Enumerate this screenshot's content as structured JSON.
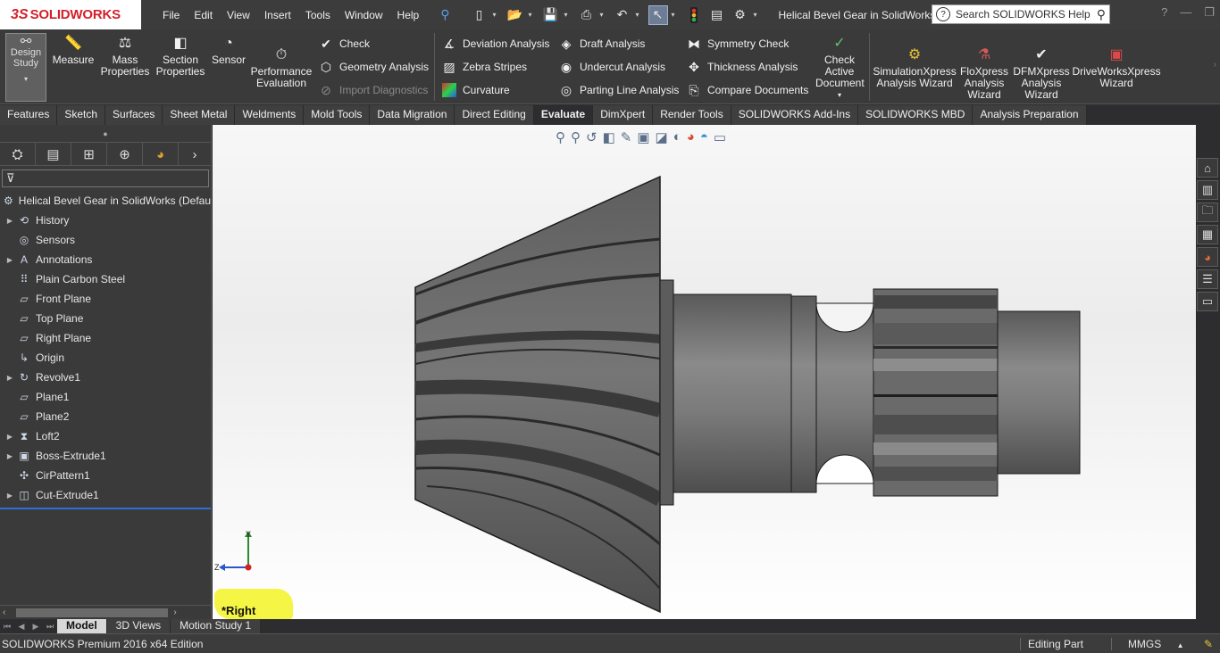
{
  "app": {
    "logo_text": "SOLIDWORKS",
    "document_title": "Helical Bevel Gear in SolidWorks",
    "search_placeholder": "Search SOLIDWORKS Help"
  },
  "menu": [
    "File",
    "Edit",
    "View",
    "Insert",
    "Tools",
    "Window",
    "Help"
  ],
  "command_manager": {
    "design_study": "Design Study",
    "large_buttons": [
      {
        "label": "Measure",
        "icon": "measure-icon"
      },
      {
        "label": "Mass Properties",
        "icon": "mass-properties-icon"
      },
      {
        "label": "Section Properties",
        "icon": "section-properties-icon"
      },
      {
        "label": "Sensor",
        "icon": "sensor-icon"
      },
      {
        "label": "Performance Evaluation",
        "icon": "performance-evaluation-icon"
      }
    ],
    "small_buttons": {
      "check": "Check",
      "geometry_analysis": "Geometry Analysis",
      "import_diagnostics": "Import Diagnostics",
      "deviation_analysis": "Deviation Analysis",
      "zebra_stripes": "Zebra Stripes",
      "curvature": "Curvature",
      "draft_analysis": "Draft Analysis",
      "undercut_analysis": "Undercut Analysis",
      "parting_line_analysis": "Parting Line Analysis",
      "symmetry_check": "Symmetry Check",
      "thickness_analysis": "Thickness Analysis",
      "compare_documents": "Compare Documents"
    },
    "check_active_document": "Check Active Document",
    "wizards": [
      "SimulationXpress Analysis Wizard",
      "FloXpress Analysis Wizard",
      "DFMXpress Analysis Wizard",
      "DriveWorksXpress Wizard"
    ]
  },
  "tabs": [
    "Features",
    "Sketch",
    "Surfaces",
    "Sheet Metal",
    "Weldments",
    "Mold Tools",
    "Data Migration",
    "Direct Editing",
    "Evaluate",
    "DimXpert",
    "Render Tools",
    "SOLIDWORKS Add-Ins",
    "SOLIDWORKS MBD",
    "Analysis Preparation"
  ],
  "active_tab": "Evaluate",
  "feature_tree": {
    "root": "Helical Bevel Gear in SolidWorks  (Defau",
    "items": [
      {
        "label": "History",
        "icon": "history-icon",
        "expandable": true
      },
      {
        "label": "Sensors",
        "icon": "sensors-icon",
        "expandable": false
      },
      {
        "label": "Annotations",
        "icon": "annotations-icon",
        "expandable": true
      },
      {
        "label": "Plain Carbon Steel",
        "icon": "material-icon",
        "expandable": false
      },
      {
        "label": "Front Plane",
        "icon": "plane-icon",
        "expandable": false
      },
      {
        "label": "Top Plane",
        "icon": "plane-icon",
        "expandable": false
      },
      {
        "label": "Right Plane",
        "icon": "plane-icon",
        "expandable": false
      },
      {
        "label": "Origin",
        "icon": "origin-icon",
        "expandable": false
      },
      {
        "label": "Revolve1",
        "icon": "revolve-icon",
        "expandable": true
      },
      {
        "label": "Plane1",
        "icon": "plane-icon",
        "expandable": false
      },
      {
        "label": "Plane2",
        "icon": "plane-icon",
        "expandable": false
      },
      {
        "label": "Loft2",
        "icon": "loft-icon",
        "expandable": true
      },
      {
        "label": "Boss-Extrude1",
        "icon": "boss-extrude-icon",
        "expandable": true
      },
      {
        "label": "CirPattern1",
        "icon": "circular-pattern-icon",
        "expandable": false
      },
      {
        "label": "Cut-Extrude1",
        "icon": "cut-extrude-icon",
        "expandable": true
      }
    ]
  },
  "viewport": {
    "view_name": "*Right",
    "triad_y": "Y",
    "triad_z": "Z"
  },
  "bottom_tabs": [
    "Model",
    "3D Views",
    "Motion Study 1"
  ],
  "active_bottom_tab": "Model",
  "status": {
    "edition": "SOLIDWORKS Premium 2016 x64 Edition",
    "mode": "Editing Part",
    "units": "MMGS"
  },
  "colors": {
    "accent_red": "#d4202b",
    "toolbar_bg": "#3a3a3a",
    "view_label_highlight": "#f5f545",
    "gear_metal": "#6b6b6b"
  }
}
